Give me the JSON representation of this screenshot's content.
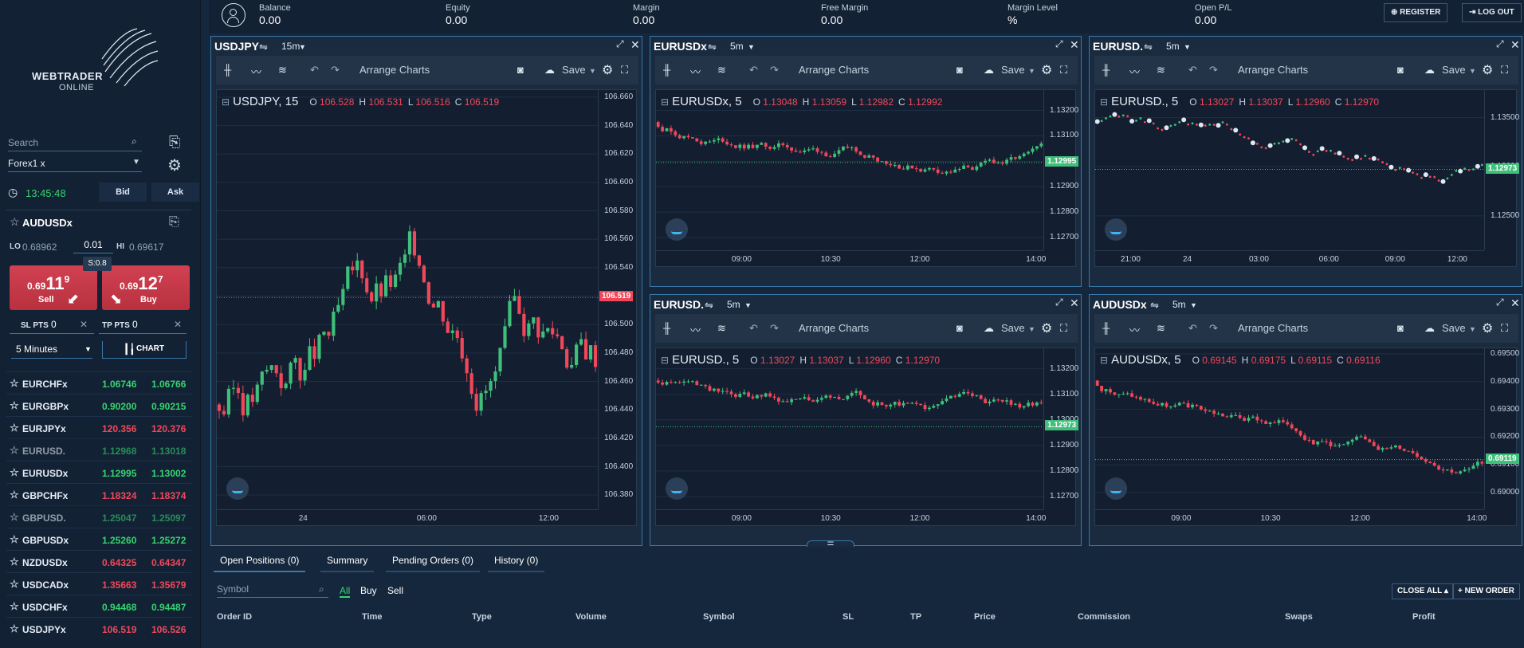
{
  "sidebar": {
    "brand": "WEBTRADER",
    "brand_sub": "ONLINE",
    "search_placeholder": "Search",
    "group_value": "Forex1 x",
    "clock": "13:45:48",
    "bid_tab": "Bid",
    "ask_tab": "Ask",
    "symbol": "AUDUSDx",
    "lo_label": "LO",
    "lo_value": "0.68962",
    "spread_value": "0.01",
    "hi_label": "HI",
    "hi_value": "0.69617",
    "spread_label": "S:0.8",
    "sell": {
      "prefix": "0.69",
      "big": "11",
      "sup": "9",
      "label": "Sell"
    },
    "buy": {
      "prefix": "0.69",
      "big": "12",
      "sup": "7",
      "label": "Buy"
    },
    "sl_label": "SL PTS",
    "sl_value": "0",
    "tp_label": "TP PTS",
    "tp_value": "0",
    "interval_value": "5 Minutes",
    "chart_button": "CHART",
    "watchlist": [
      {
        "sym": "EURCHFx",
        "bid": "1.06746",
        "ask": "1.06766",
        "color": "green",
        "dim": false
      },
      {
        "sym": "EURGBPx",
        "bid": "0.90200",
        "ask": "0.90215",
        "color": "green",
        "dim": false
      },
      {
        "sym": "EURJPYx",
        "bid": "120.356",
        "ask": "120.376",
        "color": "red",
        "dim": false
      },
      {
        "sym": "EURUSD.",
        "bid": "1.12968",
        "ask": "1.13018",
        "color": "green",
        "dim": true
      },
      {
        "sym": "EURUSDx",
        "bid": "1.12995",
        "ask": "1.13002",
        "color": "green",
        "dim": false
      },
      {
        "sym": "GBPCHFx",
        "bid": "1.18324",
        "ask": "1.18374",
        "color": "red",
        "dim": false
      },
      {
        "sym": "GBPUSD.",
        "bid": "1.25047",
        "ask": "1.25097",
        "color": "green",
        "dim": true
      },
      {
        "sym": "GBPUSDx",
        "bid": "1.25260",
        "ask": "1.25272",
        "color": "green",
        "dim": false
      },
      {
        "sym": "NZDUSDx",
        "bid": "0.64325",
        "ask": "0.64347",
        "color": "red",
        "dim": false
      },
      {
        "sym": "USDCADx",
        "bid": "1.35663",
        "ask": "1.35679",
        "color": "red",
        "dim": false
      },
      {
        "sym": "USDCHFx",
        "bid": "0.94468",
        "ask": "0.94487",
        "color": "green",
        "dim": false
      },
      {
        "sym": "USDJPYx",
        "bid": "106.519",
        "ask": "106.526",
        "color": "red",
        "dim": false
      }
    ]
  },
  "header": {
    "balance_label": "Balance",
    "balance": "0.00",
    "equity_label": "Equity",
    "equity": "0.00",
    "margin_label": "Margin",
    "margin": "0.00",
    "free_margin_label": "Free Margin",
    "free_margin": "0.00",
    "margin_level_label": "Margin Level",
    "margin_level": "%",
    "open_pl_label": "Open P/L",
    "open_pl": "0.00",
    "register": "REGISTER",
    "logout": "LOG OUT"
  },
  "toolbar": {
    "arrange": "Arrange Charts",
    "save": "Save"
  },
  "chart_data": [
    {
      "type": "candlestick",
      "title": "USDJPY",
      "timeframe": "15m",
      "legend": "USDJPY, 15",
      "o": "106.528",
      "h": "106.531",
      "l": "106.516",
      "c": "106.519",
      "yticks": [
        "106.660",
        "106.640",
        "106.620",
        "106.600",
        "106.580",
        "106.560",
        "106.540",
        "106.520",
        "106.500",
        "106.480",
        "106.460",
        "106.440",
        "106.420",
        "106.400",
        "106.380"
      ],
      "ylim": [
        106.37,
        106.665
      ],
      "xticks": [
        {
          "label": "24",
          "pos": 0.24
        },
        {
          "label": "06:00",
          "pos": 0.55
        },
        {
          "label": "12:00",
          "pos": 0.87
        }
      ],
      "last": "106.519",
      "last_value": 106.519,
      "last_color": "#f0485a"
    },
    {
      "type": "candlestick",
      "title": "EURUSDx",
      "timeframe": "5m",
      "legend": "EURUSDx, 5",
      "o": "1.13048",
      "h": "1.13059",
      "l": "1.12982",
      "c": "1.12992",
      "yticks": [
        "1.13200",
        "1.13100",
        "1.13000",
        "1.12900",
        "1.12800",
        "1.12700"
      ],
      "ylim": [
        1.1265,
        1.1328
      ],
      "xticks": [
        {
          "label": "09:00",
          "pos": 0.22
        },
        {
          "label": "10:30",
          "pos": 0.45
        },
        {
          "label": "12:00",
          "pos": 0.68
        },
        {
          "label": "14:00",
          "pos": 0.98
        }
      ],
      "last": "1.12995",
      "last_value": 1.12995,
      "last_color": "#3fbf7a"
    },
    {
      "type": "line",
      "title": "EURUSD.",
      "timeframe": "5m",
      "legend": "EURUSD., 5",
      "o": "1.13027",
      "h": "1.13037",
      "l": "1.12960",
      "c": "1.12970",
      "yticks": [
        "1.13500",
        "1.13000",
        "1.12500"
      ],
      "ylim": [
        1.1215,
        1.1378
      ],
      "xticks": [
        {
          "label": "21:00",
          "pos": 0.09
        },
        {
          "label": "24",
          "pos": 0.25
        },
        {
          "label": "03:00",
          "pos": 0.42
        },
        {
          "label": "06:00",
          "pos": 0.6
        },
        {
          "label": "09:00",
          "pos": 0.77
        },
        {
          "label": "12:00",
          "pos": 0.93
        }
      ],
      "last": "1.12973",
      "last_value": 1.12973,
      "last_color": "#3fbf7a"
    },
    {
      "type": "candlestick",
      "title": "EURUSD.",
      "timeframe": "5m",
      "legend": "EURUSD., 5",
      "o": "1.13027",
      "h": "1.13037",
      "l": "1.12960",
      "c": "1.12970",
      "yticks": [
        "1.13200",
        "1.13100",
        "1.13000",
        "1.12900",
        "1.12800",
        "1.12700"
      ],
      "ylim": [
        1.1265,
        1.1328
      ],
      "xticks": [
        {
          "label": "09:00",
          "pos": 0.22
        },
        {
          "label": "10:30",
          "pos": 0.45
        },
        {
          "label": "12:00",
          "pos": 0.68
        },
        {
          "label": "14:00",
          "pos": 0.98
        }
      ],
      "last": "1.12973",
      "last_value": 1.12973,
      "last_color": "#3fbf7a"
    },
    {
      "type": "candlestick",
      "title": "AUDUSDx",
      "timeframe": "5m",
      "legend": "AUDUSDx, 5",
      "o": "0.69145",
      "h": "0.69175",
      "l": "0.69115",
      "c": "0.69116",
      "yticks": [
        "0.69500",
        "0.69400",
        "0.69300",
        "0.69200",
        "0.69100",
        "0.69000"
      ],
      "ylim": [
        0.6894,
        0.6952
      ],
      "xticks": [
        {
          "label": "09:00",
          "pos": 0.22
        },
        {
          "label": "10:30",
          "pos": 0.45
        },
        {
          "label": "12:00",
          "pos": 0.68
        },
        {
          "label": "14:00",
          "pos": 0.98
        }
      ],
      "last": "0.69119",
      "last_value": 0.69119,
      "last_color": "#3fbf7a"
    }
  ],
  "bottom": {
    "tabs": [
      "Open Positions (0)",
      "Summary",
      "Pending Orders (0)",
      "History (0)"
    ],
    "symbol_placeholder": "Symbol",
    "filters": [
      "All",
      "Buy",
      "Sell"
    ],
    "close_all": "CLOSE ALL",
    "new_order": "NEW ORDER",
    "columns": [
      "Order ID",
      "Time",
      "Type",
      "Volume",
      "Symbol",
      "SL",
      "TP",
      "Price",
      "Commission",
      "Swaps",
      "Profit"
    ]
  }
}
